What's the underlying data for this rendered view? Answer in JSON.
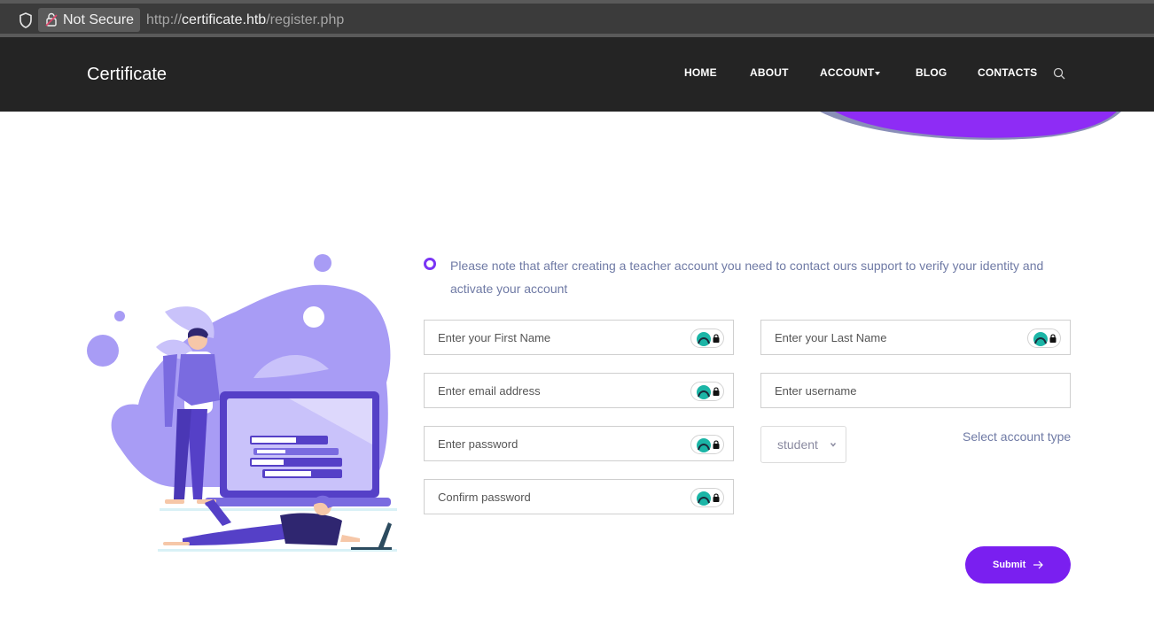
{
  "browser": {
    "security_label": "Not Secure",
    "url_scheme": "http://",
    "url_host": "certificate.htb",
    "url_path": "/register.php"
  },
  "site": {
    "brand": "Certificate",
    "nav": {
      "home": "HOME",
      "about": "ABOUT",
      "account": "ACCOUNT",
      "blog": "BLOG",
      "contacts": "CONTACTS"
    }
  },
  "form": {
    "note": "Please note that after creating a teacher account you need to contact ours support to verify your identity and activate your account",
    "first_name_placeholder": "Enter your First Name",
    "last_name_placeholder": "Enter your Last Name",
    "email_placeholder": "Enter email address",
    "username_placeholder": "Enter username",
    "password_placeholder": "Enter password",
    "confirm_placeholder": "Confirm password",
    "account_type_value": "student",
    "account_type_label": "Select account type",
    "submit_label": "Submit"
  },
  "colors": {
    "accent": "#7a1ff0",
    "nav_bg": "#242424",
    "illustration": "#a89cf5"
  },
  "icons": {
    "password_manager": "password-manager-icon",
    "search": "search-icon"
  }
}
